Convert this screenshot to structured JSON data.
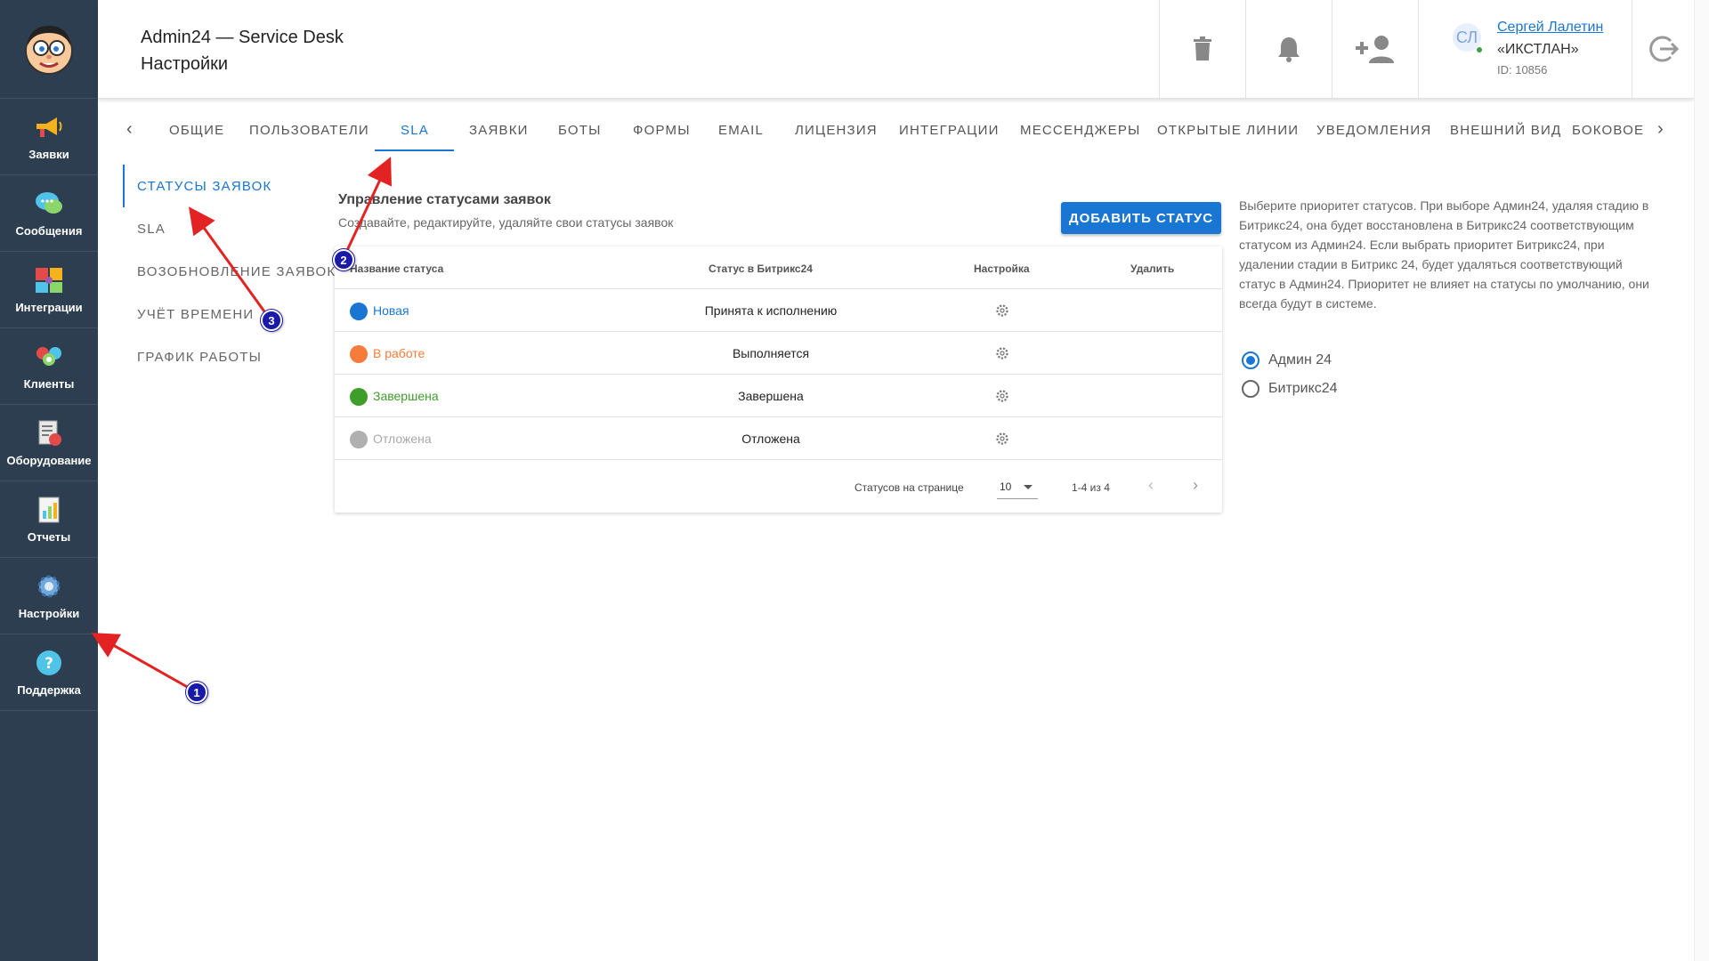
{
  "sidebar": {
    "items": [
      {
        "label": "Заявки",
        "icon": "megaphone-icon"
      },
      {
        "label": "Сообщения",
        "icon": "chat-bubbles-icon"
      },
      {
        "label": "Интеграции",
        "icon": "puzzle-icon"
      },
      {
        "label": "Клиенты",
        "icon": "clients-icon"
      },
      {
        "label": "Оборудование",
        "icon": "equipment-icon"
      },
      {
        "label": "Отчеты",
        "icon": "report-icon"
      },
      {
        "label": "Настройки",
        "icon": "gear-icon"
      },
      {
        "label": "Поддержка",
        "icon": "help-icon"
      }
    ]
  },
  "header": {
    "app_title": "Admin24 — Service Desk",
    "page_title": "Настройки",
    "user": {
      "initials": "СЛ",
      "name": "Сергей Лалетин",
      "org": "«ИКСТЛАН»",
      "id": "ID: 10856"
    }
  },
  "tabs": {
    "prev": "‹",
    "next": "›",
    "items": [
      "Общие",
      "Пользователи",
      "SLA",
      "Заявки",
      "Боты",
      "Формы",
      "Email",
      "Лицензия",
      "Интеграции",
      "Мессенджеры",
      "Открытые линии",
      "Уведомления",
      "Внешний вид",
      "Боковое"
    ],
    "active": "SLA"
  },
  "subnav": {
    "items": [
      "Статусы заявок",
      "SLA",
      "Возобновление заявок",
      "Учёт времени",
      "График работы"
    ],
    "active": "Статусы заявок"
  },
  "main": {
    "title": "Управление статусами заявок",
    "subtitle": "Создавайте, редактируйте, удаляйте свои статусы заявок",
    "add_button": "Добавить статус",
    "table": {
      "headers": [
        "Название статуса",
        "Статус в Битрикс24",
        "Настройка",
        "Удалить"
      ],
      "rows": [
        {
          "name": "Новая",
          "color": "#1976d2",
          "bitrix": "Принята к исполнению"
        },
        {
          "name": "В работе",
          "color": "#f57c3a",
          "bitrix": "Выполняется"
        },
        {
          "name": "Завершена",
          "color": "#3f9e2a",
          "bitrix": "Завершена"
        },
        {
          "name": "Отложена",
          "color": "#b0b0b0",
          "bitrix": "Отложена"
        }
      ],
      "footer": {
        "per_page_label": "Статусов на странице",
        "per_page_value": "10",
        "range": "1-4 из 4",
        "prev": "‹",
        "next": "›"
      }
    }
  },
  "info": {
    "text": "Выберите приоритет статусов. При выборе Админ24, удаляя стадию в Битрикс24, она будет восстановлена в Битрикс24 соответствующим статусом из Админ24. Если выбрать приоритет Битрикс24, при удалении стадии в Битрикс 24, будет удаляться соответствующий статус в Админ24. Приоритет не влияет на статусы по умолчанию, они всегда будут в системе.",
    "options": [
      "Админ 24",
      "Битрикс24"
    ],
    "selected": "Админ 24"
  },
  "annotations": [
    "1",
    "2",
    "3"
  ],
  "colors": {
    "sidebar_bg": "#2c3e50",
    "accent": "#1976d2",
    "arrow": "#e32323",
    "marker": "#1a1aa8"
  }
}
